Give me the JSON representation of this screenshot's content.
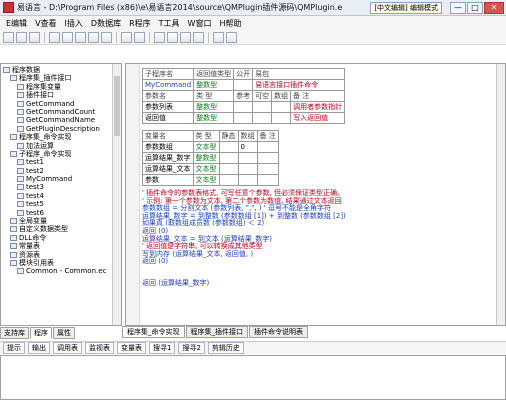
{
  "titlebar": {
    "title": "易语言 - D:\\Program Files (x86)\\e\\易语言2014\\source\\QMPlugin插件源码\\QMPlugin.e",
    "mode": "[中文编辑] 编辑模式",
    "min": "—",
    "max": "□",
    "close": "✕"
  },
  "menu": [
    "E编辑",
    "V查看",
    "I插入",
    "D数据库",
    "R程序",
    "T工具",
    "W窗口",
    "H帮助"
  ],
  "tree": [
    {
      "label": "程序数据",
      "indent": 0
    },
    {
      "label": "程序集_插件接口",
      "indent": 1
    },
    {
      "label": "程序集变量",
      "indent": 2
    },
    {
      "label": "插件接口",
      "indent": 2
    },
    {
      "label": "GetCommand",
      "indent": 2
    },
    {
      "label": "GetCommandCount",
      "indent": 2
    },
    {
      "label": "GetCommandName",
      "indent": 2
    },
    {
      "label": "GetPluginDescription",
      "indent": 2
    },
    {
      "label": "程序集_命令实现",
      "indent": 1
    },
    {
      "label": "加法运算",
      "indent": 2
    },
    {
      "label": "子程序_命令实现",
      "indent": 1
    },
    {
      "label": "test1",
      "indent": 2
    },
    {
      "label": "test2",
      "indent": 2
    },
    {
      "label": "MyCommand",
      "indent": 2
    },
    {
      "label": "test3",
      "indent": 2
    },
    {
      "label": "test4",
      "indent": 2
    },
    {
      "label": "test5",
      "indent": 2
    },
    {
      "label": "test6",
      "indent": 2
    },
    {
      "label": "全局变量",
      "indent": 1
    },
    {
      "label": "自定义数据类型",
      "indent": 1
    },
    {
      "label": "DLL命令",
      "indent": 1
    },
    {
      "label": "常量表",
      "indent": 1
    },
    {
      "label": "资源表",
      "indent": 1
    },
    {
      "label": "模块引用表",
      "indent": 1
    },
    {
      "label": "Common - Common.ec",
      "indent": 2
    }
  ],
  "left_tabs": [
    "支持库",
    "程序",
    "属性"
  ],
  "editor": {
    "header_table": {
      "cols": [
        "子程序名",
        "返回值类型",
        "公开",
        "易包"
      ],
      "row": [
        "MyCommand",
        "整数型",
        "",
        "易语言接口插件命令"
      ],
      "param_hdr": [
        "参数名",
        "类 型",
        "参考",
        "可空",
        "数组",
        "备 注"
      ],
      "params": [
        [
          "参数列表",
          "整数型",
          "",
          "",
          "",
          "调用者参数指针"
        ],
        [
          "返回值",
          "整数型",
          "",
          "",
          "",
          "写入返回值"
        ]
      ]
    },
    "var_table": {
      "hdr": [
        "变量名",
        "类 型",
        "静态",
        "数组",
        "备 注"
      ],
      "rows": [
        [
          "参数数组",
          "文本型",
          "",
          "0",
          ""
        ],
        [
          "运算结果_数字",
          "整数型",
          "",
          "",
          ""
        ],
        [
          "运算结果_文本",
          "文本型",
          "",
          "",
          ""
        ],
        [
          "参数",
          "文本型",
          "",
          "",
          ""
        ]
      ]
    },
    "code": [
      "' 插件命令的参数表格式, 可写任意个参数, 但必须保证类型正确。",
      "' 示例: 第一个参数为文本, 第二个参数为数值, 结果通过文本返回",
      "参数数组 = 分割文本 (参数列表, \",\", )  ' 逗号不能是全角字符",
      "运算结果_数字 = 到整数 (参数数组 [1]) + 到整数 (参数数组 [2])",
      "如果真 (取数组成员数 (参数数组) ＜ 2)",
      "    返回 (0)",
      "运算结果_文本 = 到文本 (运算结果_数字)",
      "' 返回值是字符串, 可以转换成其他类型",
      "写到内存 (运算结果_文本, 返回值, )",
      "返回 (0)"
    ],
    "ret_line": "返回 (运算结果_数字)"
  },
  "editor_tabs": [
    "程序集_命令实现",
    "程序集_插件接口",
    "插件命令说明表"
  ],
  "bottom_tabs": [
    "提示",
    "输出",
    "调用表",
    "监视表",
    "变量表",
    "搜寻1",
    "搜寻2",
    "剪辑历史"
  ],
  "colors": {
    "keyword": "#1a3fbf",
    "type": "#0c7d15",
    "comment": "#c4001c",
    "accent": "#d9534f"
  }
}
